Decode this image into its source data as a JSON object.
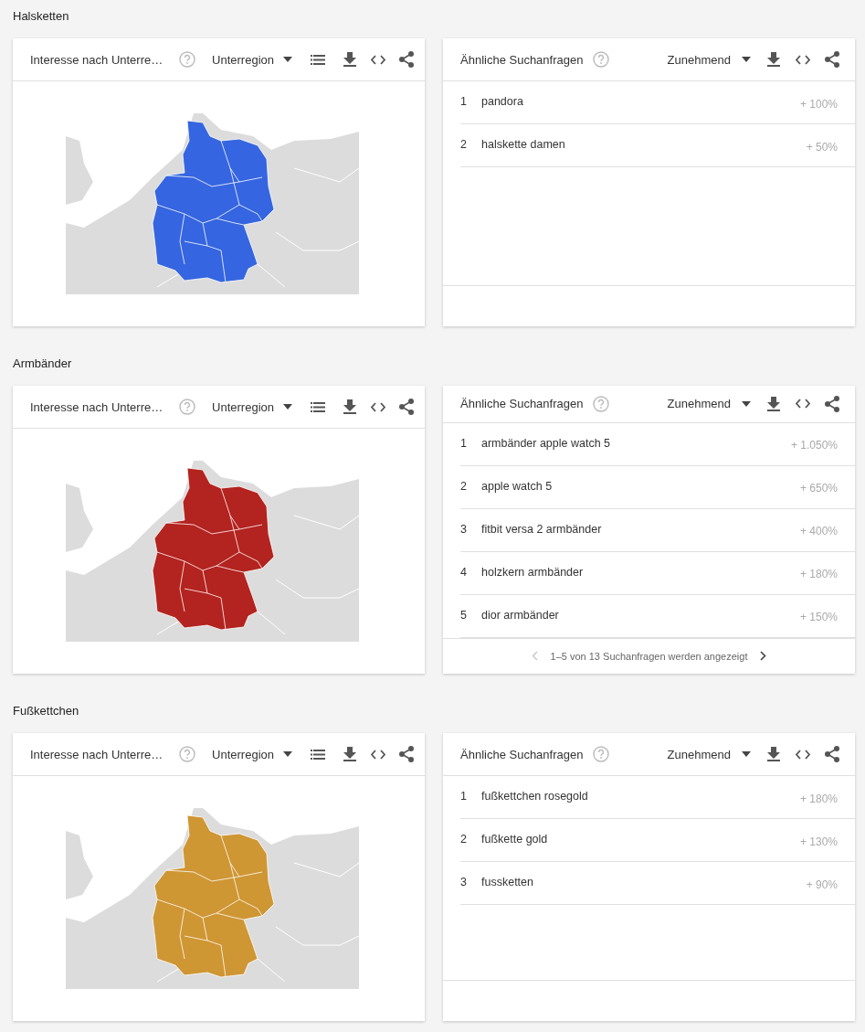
{
  "sections": [
    {
      "title": "Halsketten",
      "color": "#3565e0",
      "region_card": {
        "title": "Interesse nach Unterre…",
        "dropdown": "Unterregion"
      },
      "queries_card": {
        "title": "Ähnliche Suchanfragen",
        "dropdown": "Zunehmend",
        "rows": [
          {
            "rank": "1",
            "query": "pandora",
            "value": "+ 100%"
          },
          {
            "rank": "2",
            "query": "halskette damen",
            "value": "+ 50%"
          }
        ]
      }
    },
    {
      "title": "Armbänder",
      "color": "#b3231f",
      "region_card": {
        "title": "Interesse nach Unterre…",
        "dropdown": "Unterregion"
      },
      "queries_card": {
        "title": "Ähnliche Suchanfragen",
        "dropdown": "Zunehmend",
        "rows": [
          {
            "rank": "1",
            "query": "armbänder apple watch 5",
            "value": "+ 1.050%"
          },
          {
            "rank": "2",
            "query": "apple watch 5",
            "value": "+ 650%"
          },
          {
            "rank": "3",
            "query": "fitbit versa 2 armbänder",
            "value": "+ 400%"
          },
          {
            "rank": "4",
            "query": "holzkern armbänder",
            "value": "+ 180%"
          },
          {
            "rank": "5",
            "query": "dior armbänder",
            "value": "+ 150%"
          }
        ],
        "pagination": {
          "text": "1–5 von 13 Suchanfragen werden angezeigt",
          "prev": {
            "disabled": true
          },
          "next": {
            "disabled": false
          }
        }
      }
    },
    {
      "title": "Fußkettchen",
      "color": "#cf9634",
      "region_card": {
        "title": "Interesse nach Unterre…",
        "dropdown": "Unterregion"
      },
      "queries_card": {
        "title": "Ähnliche Suchanfragen",
        "dropdown": "Zunehmend",
        "rows": [
          {
            "rank": "1",
            "query": "fußkettchen rosegold",
            "value": "+ 180%"
          },
          {
            "rank": "2",
            "query": "fußkette gold",
            "value": "+ 130%"
          },
          {
            "rank": "3",
            "query": "fussketten",
            "value": "+ 90%"
          }
        ]
      }
    }
  ]
}
